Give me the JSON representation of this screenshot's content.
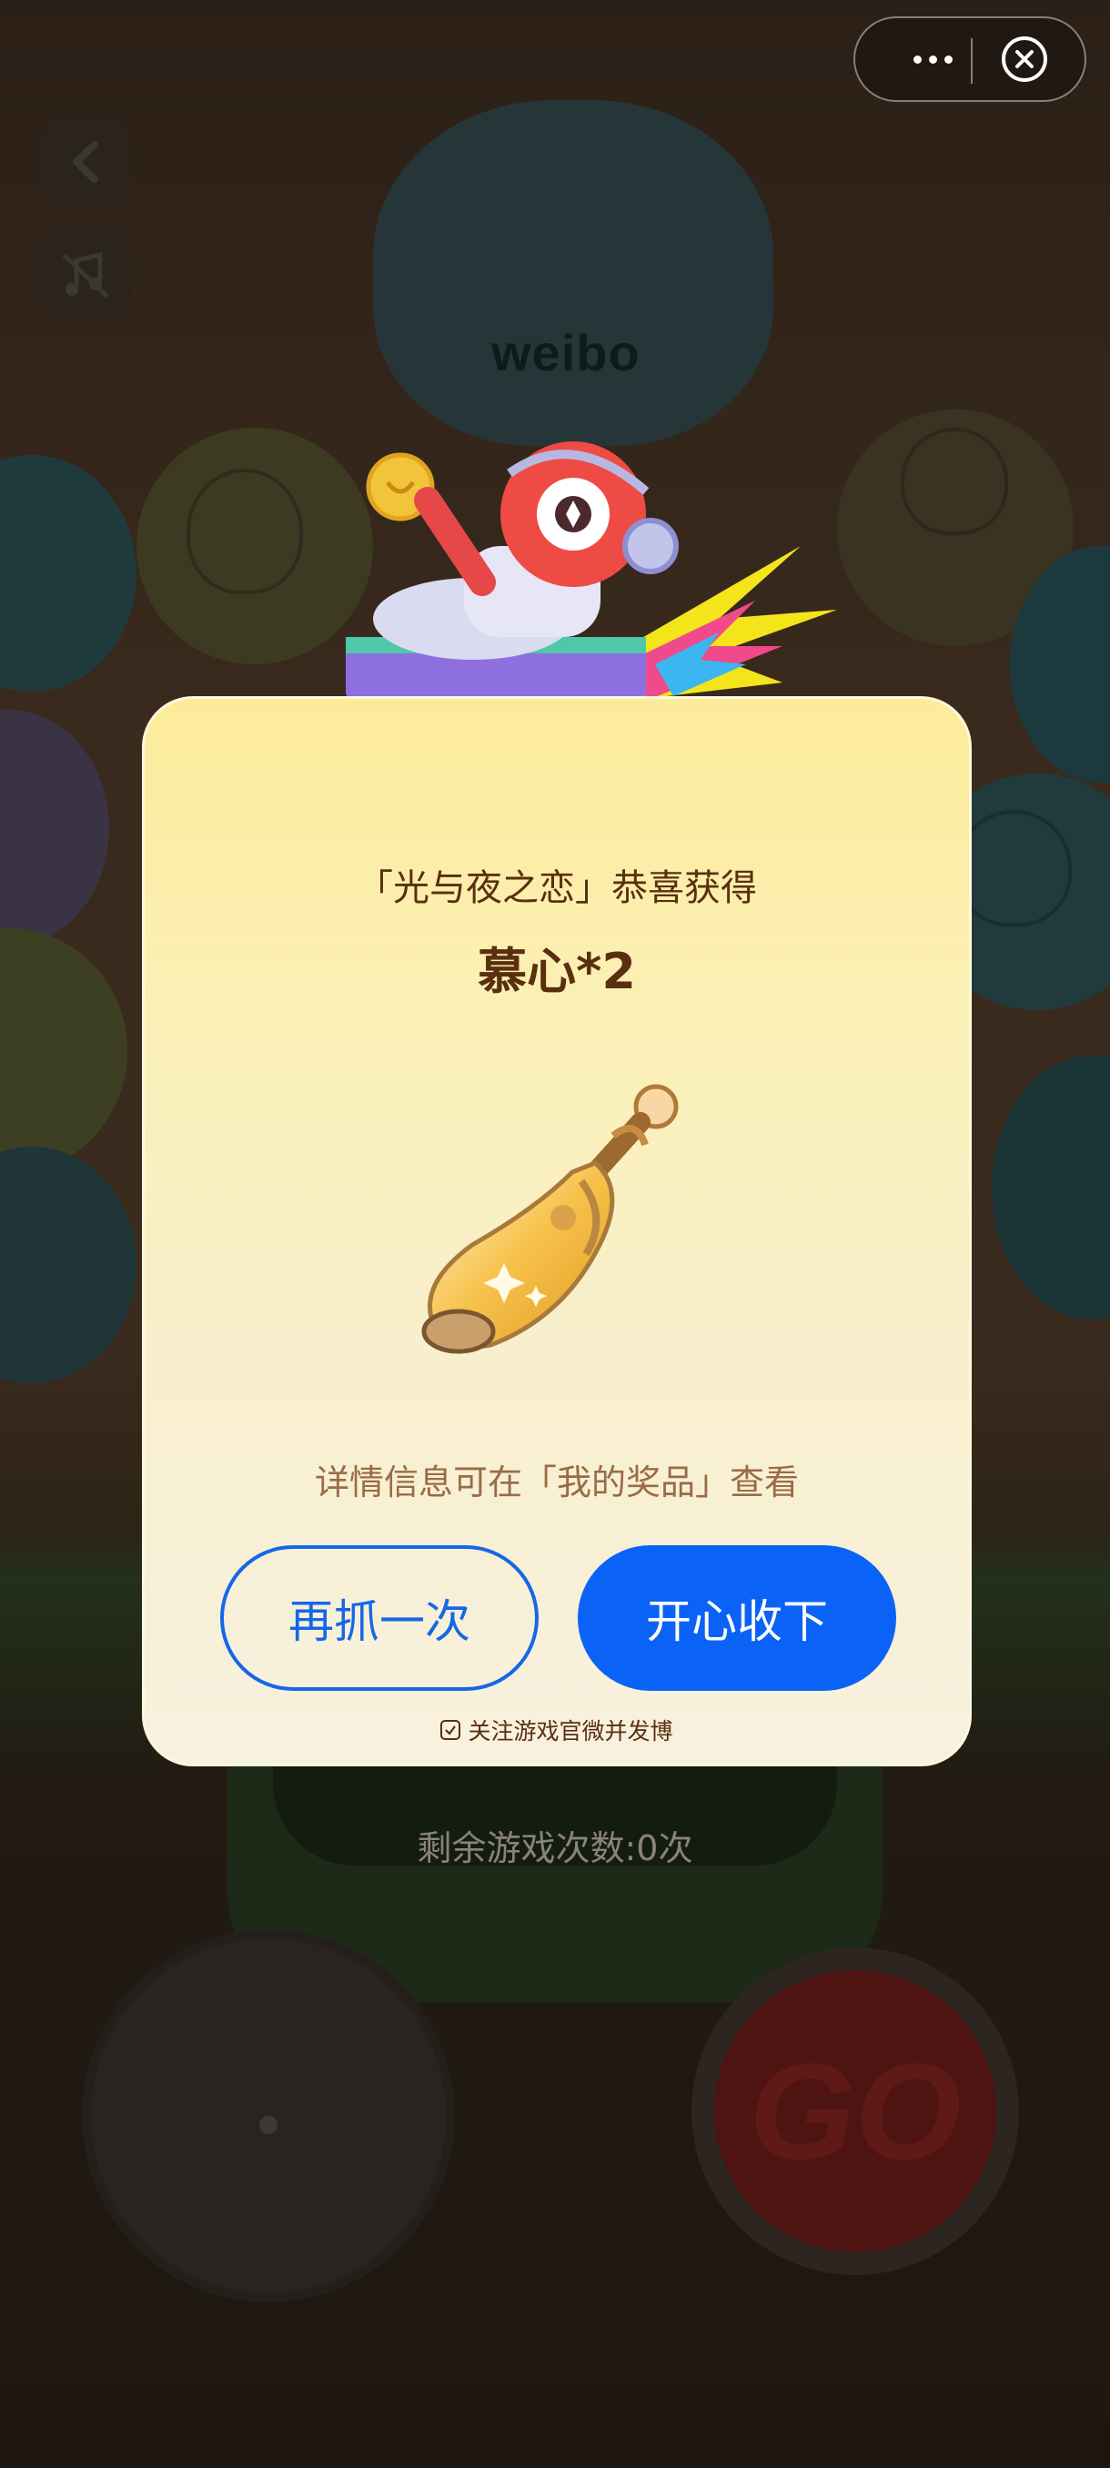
{
  "top_bar": {
    "more_icon": "more-horizontal-icon",
    "close_icon": "close-circle-icon"
  },
  "game": {
    "brand": "weibo",
    "remaining_plays": "剩余游戏次数:0次",
    "go_label": "GO",
    "back_icon": "back-arrow-icon",
    "music_icon": "music-off-icon"
  },
  "modal": {
    "subtitle": "「光与夜之恋」恭喜获得",
    "prize": "慕心*2",
    "prize_icon": "potion-bottle-icon",
    "detail": "详情信息可在「我的奖品」查看",
    "again_label": "再抓一次",
    "accept_label": "开心收下",
    "follow_label": "关注游戏官微并发博",
    "follow_checked": true
  },
  "colors": {
    "primary_blue": "#0a63f6",
    "prize_text": "#5a2f10",
    "modal_top": "#fdeb9a",
    "modal_bottom": "#f7f1df"
  }
}
